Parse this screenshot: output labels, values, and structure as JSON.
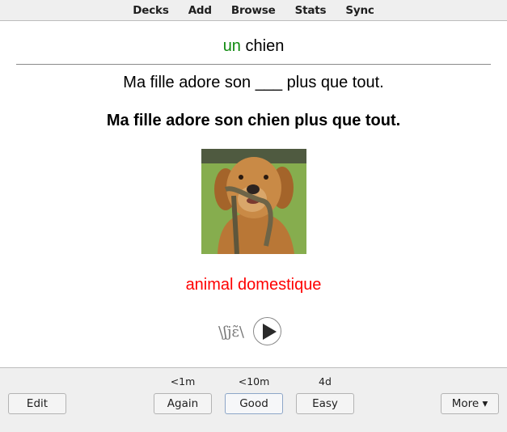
{
  "toolbar": {
    "items": [
      {
        "label": "Decks"
      },
      {
        "label": "Add"
      },
      {
        "label": "Browse"
      },
      {
        "label": "Stats"
      },
      {
        "label": "Sync"
      }
    ]
  },
  "card": {
    "front": {
      "article": "un",
      "word": "chien"
    },
    "cloze_sentence": "Ma fille adore son ___ plus que tout.",
    "full_sentence": "Ma fille adore son chien plus que tout.",
    "image": {
      "icon": "dog-photo",
      "alt": "golden retriever holding a leash"
    },
    "definition": "animal domestique",
    "pronunciation": "\\ʃjɛ̃\\",
    "audio": {
      "icon": "play-icon"
    },
    "colors": {
      "article": "#0f8a0f",
      "definition": "#ff0000"
    }
  },
  "bottom": {
    "edit_label": "Edit",
    "answers": [
      {
        "label": "Again",
        "interval": "<1m"
      },
      {
        "label": "Good",
        "interval": "<10m",
        "default": true
      },
      {
        "label": "Easy",
        "interval": "4d"
      }
    ],
    "more_label": "More ▾"
  }
}
